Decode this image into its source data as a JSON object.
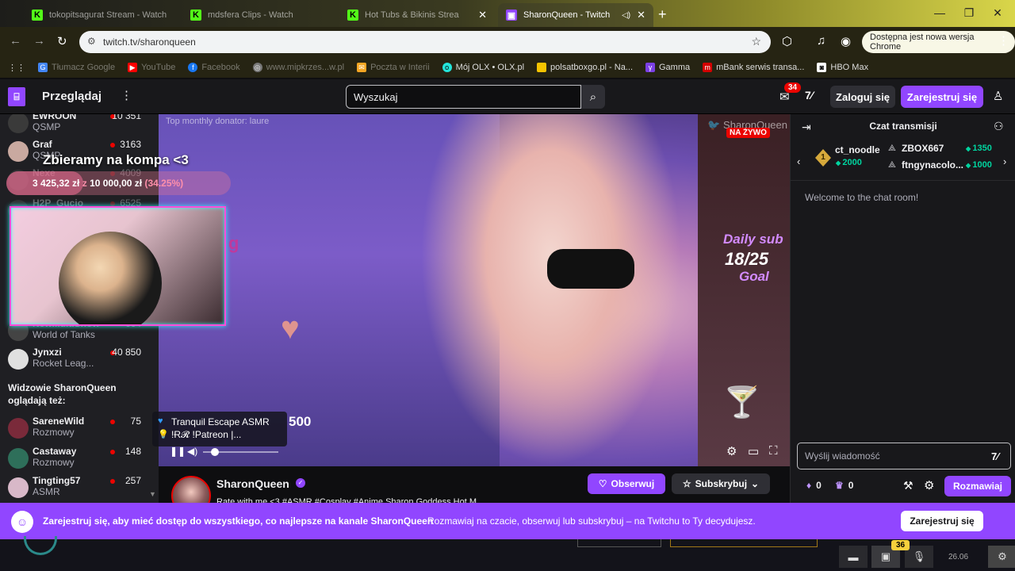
{
  "browser": {
    "tabs": [
      {
        "label": "tokopitsagurat Stream - Watch",
        "favicon": "kick-icon",
        "active": false
      },
      {
        "label": "mdsfera Clips - Watch",
        "favicon": "kick-icon",
        "active": false
      },
      {
        "label": "Hot Tubs & Bikinis Strea",
        "favicon": "kick-icon",
        "active": false
      },
      {
        "label": "SharonQueen - Twitch",
        "favicon": "twitch-icon",
        "active": true
      }
    ],
    "url": "twitch.tv/sharonqueen",
    "update_chip": "Dostępna jest nowa wersja Chrome",
    "bookmarks": [
      {
        "label": "Tłumacz Google",
        "dim": true,
        "color": "#4285f4"
      },
      {
        "label": "YouTube",
        "dim": true,
        "color": "#ff0000"
      },
      {
        "label": "Facebook",
        "dim": true,
        "color": "#1877f2"
      },
      {
        "label": "www.mipkrzes...w.pl",
        "dim": true,
        "color": "#777777"
      },
      {
        "label": "Poczta w Interii",
        "dim": true,
        "color": "#f5a623"
      },
      {
        "label": "Mój OLX • OLX.pl",
        "dim": false,
        "color": "#23e5db"
      },
      {
        "label": "polsatboxgo.pl - Na...",
        "dim": false,
        "color": "#f5c400"
      },
      {
        "label": "Gamma",
        "dim": false,
        "color": "#7b3fe4"
      },
      {
        "label": "mBank serwis transa...",
        "dim": false,
        "color": "#d40000"
      },
      {
        "label": "HBO Max",
        "dim": false,
        "color": "#ffffff"
      }
    ]
  },
  "nav": {
    "browse": "Przeglądaj",
    "search_placeholder": "Wyszukaj",
    "notifications_count": "34",
    "login": "Zaloguj się",
    "signup": "Zarejestruj się"
  },
  "sidebar": {
    "channels_top": [
      {
        "name": "EWROON",
        "category": "QSMP",
        "viewers": "10 351",
        "avatar_color": "#3a3a3a"
      },
      {
        "name": "Graf",
        "category": "QSMP",
        "viewers": "3163",
        "avatar_color": "#c9a9a0"
      },
      {
        "name": "Nexe",
        "category": "",
        "viewers": "4009",
        "avatar_color": "#555555"
      },
      {
        "name": "H2P_Gucio",
        "category": "",
        "viewers": "6525",
        "avatar_color": "#555555"
      },
      {
        "name": "NewMultiShow",
        "category": "World of Tanks",
        "viewers": "664",
        "avatar_color": "#444444"
      },
      {
        "name": "Jynxzi",
        "category": "Rocket Leag...",
        "viewers": "40 850",
        "avatar_color": "#e0e0e0"
      }
    ],
    "also_watching_heading": "Widzowie SharonQueen oglądają też:",
    "also_watching": [
      {
        "name": "SareneWild",
        "category": "Rozmowy",
        "viewers": "75",
        "avatar_color": "#7a2a3a"
      },
      {
        "name": "Castaway",
        "category": "Rozmowy",
        "viewers": "148",
        "avatar_color": "#2e6f5a"
      },
      {
        "name": "Tingting57",
        "category": "ASMR",
        "viewers": "257",
        "avatar_color": "#d8b8c8"
      }
    ]
  },
  "video": {
    "donator_text": "Top monthly donator: laure",
    "watermark": "SharonQueen",
    "live_badge": "NA ŻYWO",
    "fundraiser_title": "Zbieramy na kompa <3",
    "fundraiser_current": "3 425,32 zł",
    "fundraiser_sep": "z",
    "fundraiser_target": "10 000,00 zł",
    "fundraiser_pct": "(34.25%)",
    "fundraiser_progress": 0.3425,
    "goal_title": "Daily sub",
    "goal_count": "18/25",
    "goal_word": "Goal",
    "amount_text": "500",
    "music_title": "Tranquil Escape ASMR",
    "music_sub": "!Ɍ𝓡 !Patreon |..."
  },
  "channel": {
    "name": "SharonQueen",
    "follow": "Obserwuj",
    "subscribe": "Subskrybuj",
    "title_strip": "Rate with me <3 #ASMR #Cosplay #Anime Sharon Goddess Hot M..."
  },
  "chat": {
    "title": "Czat transmisji",
    "leaderboard": [
      {
        "name": "ct_noodle",
        "points": "2000",
        "rank": "1"
      },
      {
        "name": "ZBOX667",
        "points": "1350"
      },
      {
        "name": "ftngynacolo...",
        "points": "1000"
      }
    ],
    "welcome": "Welcome to the chat room!",
    "input_placeholder": "Wyślij wiadomość",
    "points_a": "0",
    "points_b": "0",
    "send": "Rozmawiaj"
  },
  "banner": {
    "strong": "Zarejestruj się, aby mieć dostęp do wszystkiego, co najlepsze na kanale SharonQueen",
    "text": "Rozmawiaj na czacie, obserwuj lub subskrybuj – na Twitchu to Ty decydujesz.",
    "button": "Zarejestruj się"
  },
  "taskbar": {
    "badge": "36",
    "time": "26.06"
  },
  "colors": {
    "twitch_purple": "#9146ff",
    "live_red": "#eb0400",
    "points_green": "#00d5a0"
  }
}
